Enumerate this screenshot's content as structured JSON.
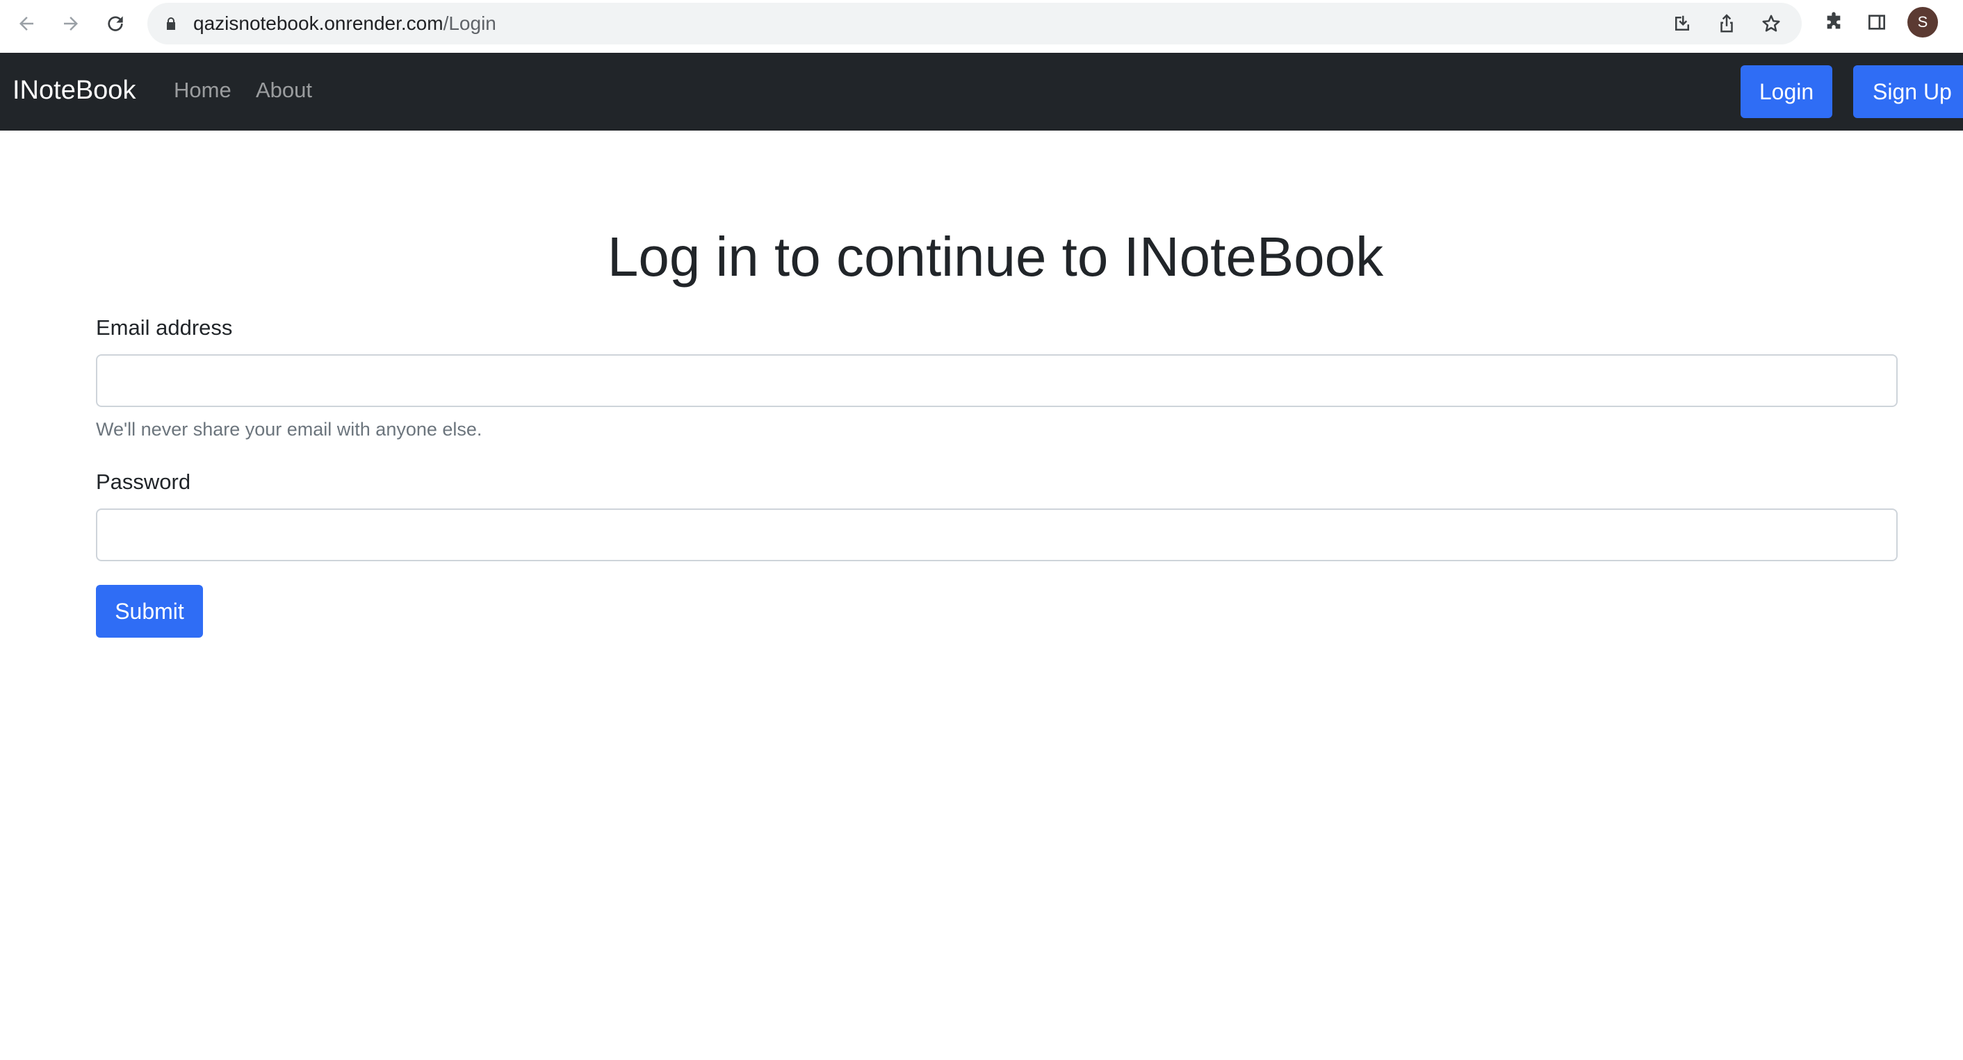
{
  "browser": {
    "url_host": "qazisnotebook.onrender.com",
    "url_path": "/Login",
    "profile_initial": "S",
    "icons": [
      "back-arrow-icon",
      "forward-arrow-icon",
      "reload-icon",
      "lock-icon",
      "install-icon",
      "share-icon",
      "star-icon",
      "extensions-icon",
      "side-panel-icon"
    ]
  },
  "navbar": {
    "brand": "INoteBook",
    "links": [
      "Home",
      "About"
    ],
    "login_label": "Login",
    "signup_label": "Sign Up"
  },
  "main": {
    "heading": "Log in to continue to INoteBook",
    "email_label": "Email address",
    "email_value": "",
    "email_help": "We'll never share your email with anyone else.",
    "password_label": "Password",
    "password_value": "",
    "submit_label": "Submit"
  },
  "colors": {
    "navbar_bg": "#212529",
    "primary": "#2f6df5",
    "text": "#212529",
    "muted": "#6c757d"
  }
}
